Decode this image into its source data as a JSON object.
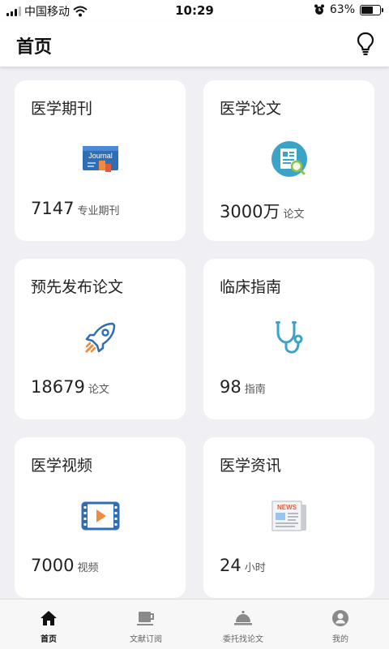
{
  "status_bar": {
    "carrier": "中国移动",
    "time": "10:29",
    "battery": "63%",
    "battery_level": 0.63
  },
  "header": {
    "title": "首页",
    "action_icon": "lightbulb-icon"
  },
  "cards": [
    {
      "title": "医学期刊",
      "value": "7147",
      "unit": "专业期刊",
      "icon": "journal-icon"
    },
    {
      "title": "医学论文",
      "value": "3000万",
      "unit": "论文",
      "icon": "paper-search-icon"
    },
    {
      "title": "预先发布论文",
      "value": "18679",
      "unit": "论文",
      "icon": "rocket-icon"
    },
    {
      "title": "临床指南",
      "value": "98",
      "unit": "指南",
      "icon": "stethoscope-icon"
    },
    {
      "title": "医学视频",
      "value": "7000",
      "unit": "视频",
      "icon": "video-icon"
    },
    {
      "title": "医学资讯",
      "value": "24",
      "unit": "小时",
      "icon": "news-icon"
    }
  ],
  "tabbar": [
    {
      "label": "首页",
      "icon": "home-icon",
      "active": true
    },
    {
      "label": "文献订阅",
      "icon": "cup-icon",
      "active": false
    },
    {
      "label": "委托找论文",
      "icon": "service-bell-icon",
      "active": false
    },
    {
      "label": "我的",
      "icon": "user-icon",
      "active": false
    }
  ],
  "colors": {
    "background": "#f0eff4",
    "card": "#ffffff",
    "journal_blue": "#2f6db5",
    "accent_orange": "#f08a3c",
    "icon_teal": "#3aa3c7",
    "tab_icon_gray": "#8a8a8a"
  }
}
